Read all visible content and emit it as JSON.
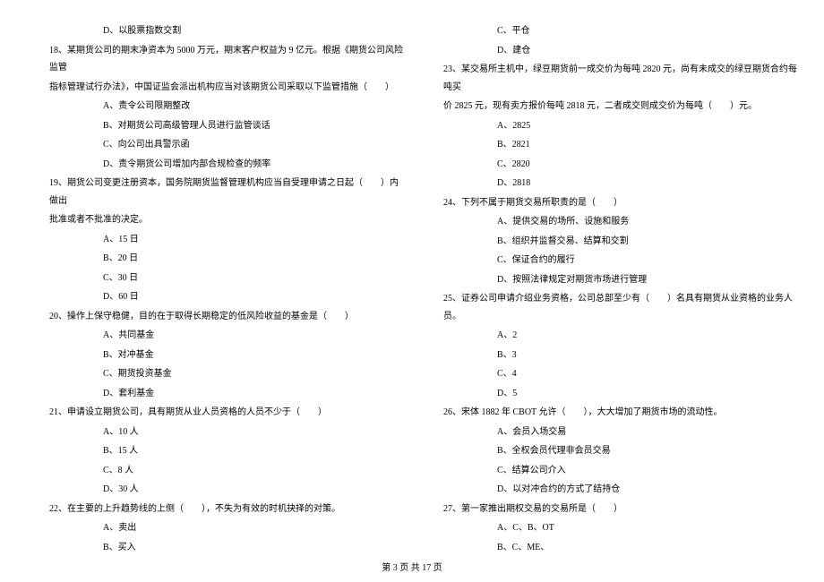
{
  "left": {
    "pre_option": "D、以股票指数交割",
    "q18": {
      "stem1": "18、某期货公司的期末净资本为 5000 万元，期末客户权益为 9 亿元。根据《期货公司风险监管",
      "stem2": "指标管理试行办法》，中国证监会派出机构应当对该期货公司采取以下监管措施（　　）",
      "a": "A、责令公司限期整改",
      "b": "B、对期货公司高级管理人员进行监管谈话",
      "c": "C、向公司出具警示函",
      "d": "D、责令期货公司增加内部合规检查的频率"
    },
    "q19": {
      "stem1": "19、期货公司变更注册资本，国务院期货监督管理机构应当自受理申请之日起（　　）内做出",
      "stem2": "批准或者不批准的决定。",
      "a": "A、15 日",
      "b": "B、20 日",
      "c": "C、30 日",
      "d": "D、60 日"
    },
    "q20": {
      "stem": "20、操作上保守稳健，目的在于取得长期稳定的低风险收益的基金是（　　）",
      "a": "A、共同基金",
      "b": "B、对冲基金",
      "c": "C、期货投资基金",
      "d": "D、套利基金"
    },
    "q21": {
      "stem": "21、申请设立期货公司，具有期货从业人员资格的人员不少于（　　）",
      "a": "A、10 人",
      "b": "B、15 人",
      "c": "C、8 人",
      "d": "D、30 人"
    },
    "q22": {
      "stem": "22、在主要的上升趋势线的上侧（　　），不失为有效的时机抉择的对策。",
      "a": "A、卖出",
      "b": "B、买入"
    }
  },
  "right": {
    "pre_c": "C、平仓",
    "pre_d": "D、建仓",
    "q23": {
      "stem1": "23、某交易所主机中，绿豆期货前一成交价为每吨 2820 元，尚有未成交的绿豆期货合约每吨买",
      "stem2": "价 2825 元，现有卖方报价每吨 2818 元，二者成交则成交价为每吨（　　）元。",
      "a": "A、2825",
      "b": "B、2821",
      "c": "C、2820",
      "d": "D、2818"
    },
    "q24": {
      "stem": "24、下列不属于期货交易所职责的是（　　）",
      "a": "A、提供交易的场所、设施和服务",
      "b": "B、组织并监督交易、结算和交割",
      "c": "C、保证合约的履行",
      "d": "D、按照法律规定对期货市场进行管理"
    },
    "q25": {
      "stem": "25、证券公司申请介绍业务资格，公司总部至少有（　　）名具有期货从业资格的业务人员。",
      "a": "A、2",
      "b": "B、3",
      "c": "C、4",
      "d": "D、5"
    },
    "q26": {
      "stem": "26、宋体 1882 年 CBOT 允许（　　），大大增加了期货市场的流动性。",
      "a": "A、会员入场交易",
      "b": "B、全权会员代理非会员交易",
      "c": "C、结算公司介入",
      "d": "D、以对冲合约的方式了结持仓"
    },
    "q27": {
      "stem": "27、第一家推出期权交易的交易所是（　　）",
      "a": "A、C、B、OT",
      "b": "B、C、ME、"
    }
  },
  "footer": "第 3 页 共 17 页"
}
